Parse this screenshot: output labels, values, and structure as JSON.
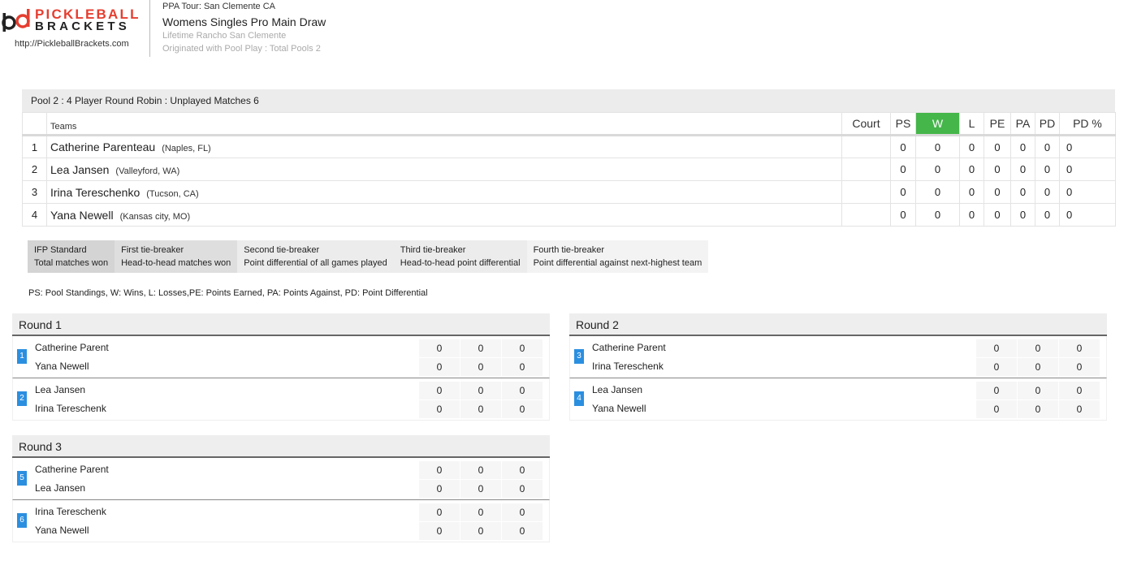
{
  "brand": {
    "logo_mark": "pb",
    "logo_line1": "PICKLEBALL",
    "logo_line2": "BRACKETS",
    "url": "http://PickleballBrackets.com",
    "accent_color": "#e53e30"
  },
  "header": {
    "tour": "PPA Tour: San Clemente CA",
    "title": "Womens Singles Pro Main Draw",
    "venue": "Lifetime Rancho San Clemente",
    "origin": "Originated with Pool Play : Total Pools 2"
  },
  "pool": {
    "title": "Pool 2 : 4 Player Round Robin : Unplayed Matches 6",
    "columns": {
      "teams": "Teams",
      "court": "Court",
      "ps": "PS",
      "w": "W",
      "l": "L",
      "pe": "PE",
      "pa": "PA",
      "pd": "PD",
      "pd_pct": "PD %"
    },
    "rows": [
      {
        "num": "1",
        "name": "Catherine Parenteau",
        "location": "(Naples, FL)",
        "court": "",
        "ps": "0",
        "w": "0",
        "l": "0",
        "pe": "0",
        "pa": "0",
        "pd": "0",
        "pd_pct": "0"
      },
      {
        "num": "2",
        "name": "Lea Jansen",
        "location": "(Valleyford, WA)",
        "court": "",
        "ps": "0",
        "w": "0",
        "l": "0",
        "pe": "0",
        "pa": "0",
        "pd": "0",
        "pd_pct": "0"
      },
      {
        "num": "3",
        "name": "Irina Tereschenko",
        "location": "(Tucson, CA)",
        "court": "",
        "ps": "0",
        "w": "0",
        "l": "0",
        "pe": "0",
        "pa": "0",
        "pd": "0",
        "pd_pct": "0"
      },
      {
        "num": "4",
        "name": "Yana Newell",
        "location": "(Kansas city, MO)",
        "court": "",
        "ps": "0",
        "w": "0",
        "l": "0",
        "pe": "0",
        "pa": "0",
        "pd": "0",
        "pd_pct": "0"
      }
    ]
  },
  "tiebreakers": [
    {
      "title": "IFP Standard",
      "desc": "Total matches won"
    },
    {
      "title": "First tie-breaker",
      "desc": "Head-to-head matches won"
    },
    {
      "title": "Second tie-breaker",
      "desc": "Point differential of all games played"
    },
    {
      "title": "Third tie-breaker",
      "desc": "Head-to-head point differential"
    },
    {
      "title": "Fourth tie-breaker",
      "desc": "Point differential against next-highest team"
    }
  ],
  "legend": "PS: Pool Standings, W: Wins, L: Losses,PE: Points Earned, PA: Points Against, PD: Point Differential",
  "rounds": [
    {
      "title": "Round 1",
      "matches": [
        {
          "num": "1",
          "a": "Catherine Parent",
          "b": "Yana Newell",
          "a_scores": [
            "0",
            "0",
            "0"
          ],
          "b_scores": [
            "0",
            "0",
            "0"
          ]
        },
        {
          "num": "2",
          "a": "Lea Jansen",
          "b": "Irina Tereschenk",
          "a_scores": [
            "0",
            "0",
            "0"
          ],
          "b_scores": [
            "0",
            "0",
            "0"
          ]
        }
      ]
    },
    {
      "title": "Round 2",
      "matches": [
        {
          "num": "3",
          "a": "Catherine Parent",
          "b": "Irina Tereschenk",
          "a_scores": [
            "0",
            "0",
            "0"
          ],
          "b_scores": [
            "0",
            "0",
            "0"
          ]
        },
        {
          "num": "4",
          "a": "Lea Jansen",
          "b": "Yana Newell",
          "a_scores": [
            "0",
            "0",
            "0"
          ],
          "b_scores": [
            "0",
            "0",
            "0"
          ]
        }
      ]
    },
    {
      "title": "Round 3",
      "matches": [
        {
          "num": "5",
          "a": "Catherine Parent",
          "b": "Lea Jansen",
          "a_scores": [
            "0",
            "0",
            "0"
          ],
          "b_scores": [
            "0",
            "0",
            "0"
          ]
        },
        {
          "num": "6",
          "a": "Irina Tereschenk",
          "b": "Yana Newell",
          "a_scores": [
            "0",
            "0",
            "0"
          ],
          "b_scores": [
            "0",
            "0",
            "0"
          ]
        }
      ]
    }
  ]
}
